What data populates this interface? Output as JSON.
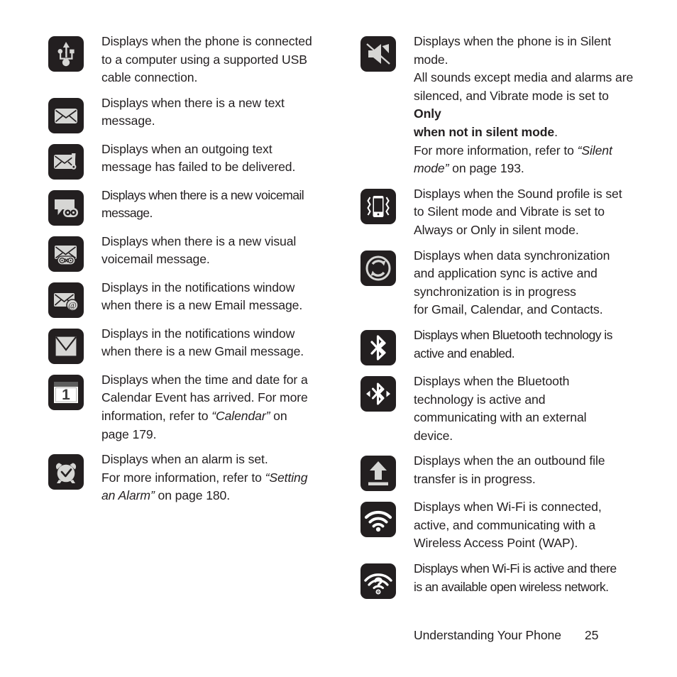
{
  "page": {
    "footer_section": "Understanding Your Phone",
    "footer_page_number": "25",
    "background_color": "#ffffff",
    "text_color": "#231f20",
    "icon_background_color": "#231f20",
    "icon_glyph_color": "#d6d6d4"
  },
  "left_column": [
    {
      "icon": "usb-icon",
      "lines": [
        "Displays when the phone is connected",
        "to a computer using a supported USB",
        "cable connection."
      ]
    },
    {
      "icon": "new-text-message-icon",
      "lines": [
        "Displays when there is a new text",
        "message."
      ]
    },
    {
      "icon": "failed-text-message-icon",
      "lines": [
        "Displays when an outgoing text",
        "message has failed to be delivered."
      ]
    },
    {
      "icon": "voicemail-icon",
      "lines": [
        "Displays when there is a new voicemail",
        "message."
      ]
    },
    {
      "icon": "visual-voicemail-icon",
      "lines": [
        "Displays when there is a new visual",
        "voicemail message."
      ]
    },
    {
      "icon": "email-message-icon",
      "lines": [
        "Displays in the notifications window",
        "when there is a new Email message."
      ]
    },
    {
      "icon": "gmail-message-icon",
      "lines": [
        "Displays in the notifications window",
        "when there is a new Gmail message."
      ]
    },
    {
      "icon": "calendar-event-icon",
      "lines": [
        "Displays when the time and date for a",
        "Calendar Event has arrived. For more",
        "information, refer to “Calendar”  on",
        "page 179."
      ],
      "italic_ref": "“Calendar”"
    },
    {
      "icon": "alarm-clock-icon",
      "lines": [
        "Displays when an alarm is set.",
        "For more information, refer to “Setting",
        "an Alarm”  on page 180."
      ],
      "italic_ref": "“Setting an Alarm”"
    }
  ],
  "right_column": [
    {
      "icon": "silent-mode-icon",
      "lines": [
        "Displays when the phone is in Silent",
        "mode.",
        "All sounds except media and alarms are",
        "silenced, and Vibrate mode is set to Only",
        "when not in silent mode.",
        "For more information, refer to “Silent",
        "mode”  on page 193."
      ],
      "bold_ref": "Only when not in silent mode",
      "italic_ref": "“Silent mode”"
    },
    {
      "icon": "vibrate-icon",
      "lines": [
        "Displays when the Sound profile is set",
        "to Silent mode and Vibrate is set to",
        "Always or Only in silent mode."
      ]
    },
    {
      "icon": "sync-icon",
      "lines": [
        "Displays when data synchronization",
        "and application sync is active and",
        "synchronization is in progress",
        "for Gmail, Calendar, and Contacts."
      ]
    },
    {
      "icon": "bluetooth-icon",
      "lines": [
        "Displays when Bluetooth technology is",
        "active and enabled."
      ]
    },
    {
      "icon": "bluetooth-connected-icon",
      "lines": [
        "Displays when the Bluetooth",
        "technology is active and",
        "communicating with an external",
        "device."
      ]
    },
    {
      "icon": "file-upload-icon",
      "lines": [
        "Displays when the an outbound file",
        "transfer is in progress."
      ]
    },
    {
      "icon": "wifi-connected-icon",
      "lines": [
        "Displays when Wi-Fi is connected,",
        "active, and communicating with a",
        "Wireless Access Point (WAP)."
      ]
    },
    {
      "icon": "wifi-open-network-icon",
      "lines": [
        "Displays when Wi-Fi is active and there",
        "is an available open wireless network."
      ]
    }
  ]
}
